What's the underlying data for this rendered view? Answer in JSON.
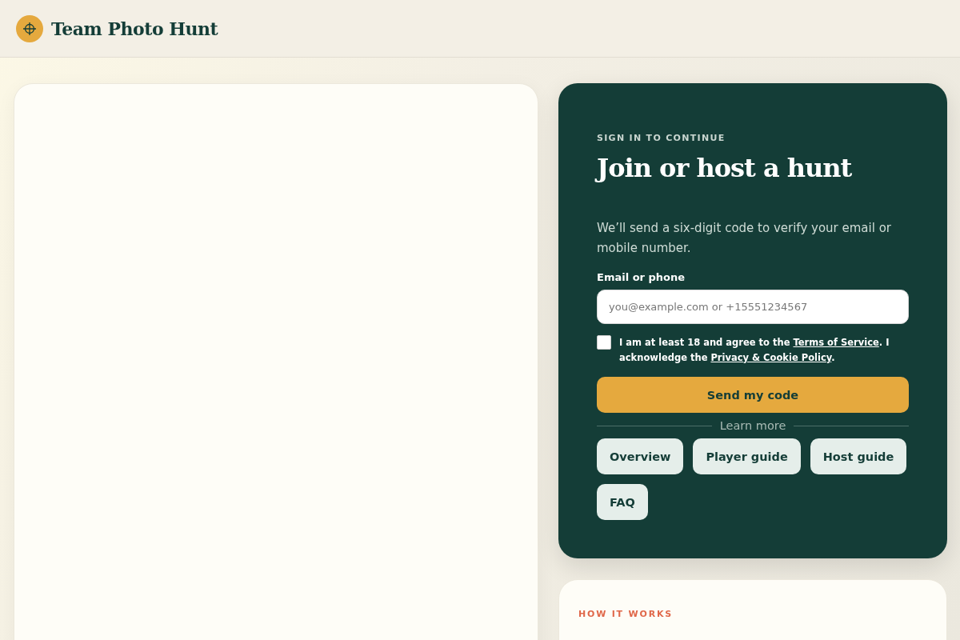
{
  "header": {
    "brand": "Team Photo Hunt"
  },
  "sign_in": {
    "eyebrow": "SIGN IN TO CONTINUE",
    "title": "Join or host a hunt",
    "description": "We’ll send a six-digit code to verify your email or mobile number.",
    "field_label": "Email or phone",
    "placeholder": "you@example.com or +15551234567",
    "consent": {
      "checked": false,
      "parts": [
        {
          "kind": "text",
          "text": "I am at least 18 and agree to the "
        },
        {
          "kind": "link",
          "text": "Terms of Service"
        },
        {
          "kind": "text",
          "text": ". I acknowledge the "
        },
        {
          "kind": "link",
          "text": "Privacy & Cookie Policy"
        },
        {
          "kind": "text",
          "text": "."
        }
      ]
    },
    "submit": "Send my code",
    "divider": "Learn more",
    "links": [
      "Overview",
      "Player guide",
      "Host guide",
      "FAQ"
    ]
  },
  "how_it_works": {
    "eyebrow": "HOW IT WORKS"
  }
}
